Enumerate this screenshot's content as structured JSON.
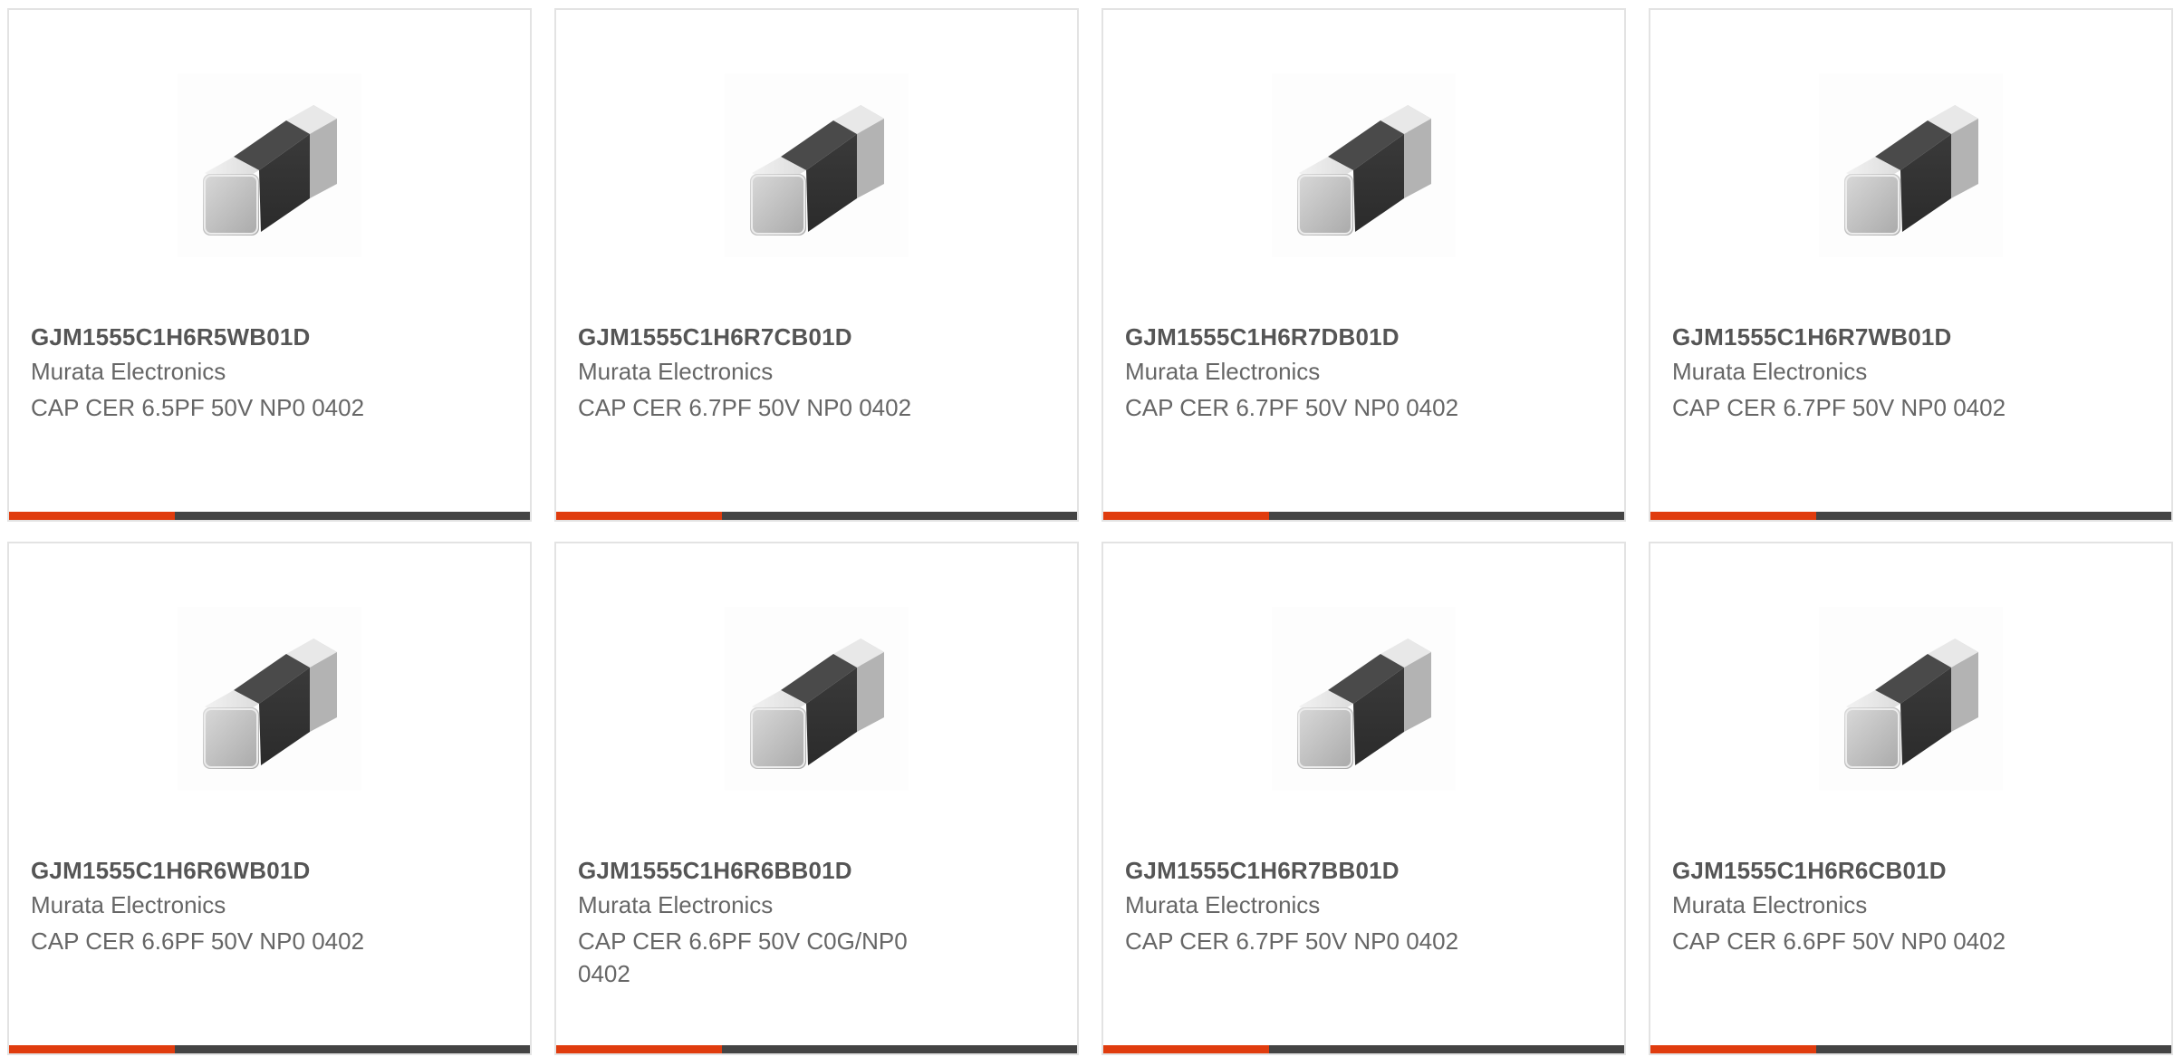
{
  "colors": {
    "accent": "#e03c0e",
    "bar": "#444444",
    "border": "#e3e3e3",
    "title_text": "#555555",
    "body_text": "#666666"
  },
  "products": [
    {
      "part_number": "GJM1555C1H6R5WB01D",
      "manufacturer": "Murata Electronics",
      "description": "CAP CER 6.5PF 50V NP0 0402",
      "image_icon": "ceramic-capacitor-chip-icon"
    },
    {
      "part_number": "GJM1555C1H6R7CB01D",
      "manufacturer": "Murata Electronics",
      "description": "CAP CER 6.7PF 50V NP0 0402",
      "image_icon": "ceramic-capacitor-chip-icon"
    },
    {
      "part_number": "GJM1555C1H6R7DB01D",
      "manufacturer": "Murata Electronics",
      "description": "CAP CER 6.7PF 50V NP0 0402",
      "image_icon": "ceramic-capacitor-chip-icon"
    },
    {
      "part_number": "GJM1555C1H6R7WB01D",
      "manufacturer": "Murata Electronics",
      "description": "CAP CER 6.7PF 50V NP0 0402",
      "image_icon": "ceramic-capacitor-chip-icon"
    },
    {
      "part_number": "GJM1555C1H6R6WB01D",
      "manufacturer": "Murata Electronics",
      "description": "CAP CER 6.6PF 50V NP0 0402",
      "image_icon": "ceramic-capacitor-chip-icon"
    },
    {
      "part_number": "GJM1555C1H6R6BB01D",
      "manufacturer": "Murata Electronics",
      "description": "CAP CER 6.6PF 50V C0G/NP0 0402",
      "image_icon": "ceramic-capacitor-chip-icon"
    },
    {
      "part_number": "GJM1555C1H6R7BB01D",
      "manufacturer": "Murata Electronics",
      "description": "CAP CER 6.7PF 50V NP0 0402",
      "image_icon": "ceramic-capacitor-chip-icon"
    },
    {
      "part_number": "GJM1555C1H6R6CB01D",
      "manufacturer": "Murata Electronics",
      "description": "CAP CER 6.6PF 50V NP0 0402",
      "image_icon": "ceramic-capacitor-chip-icon"
    }
  ]
}
